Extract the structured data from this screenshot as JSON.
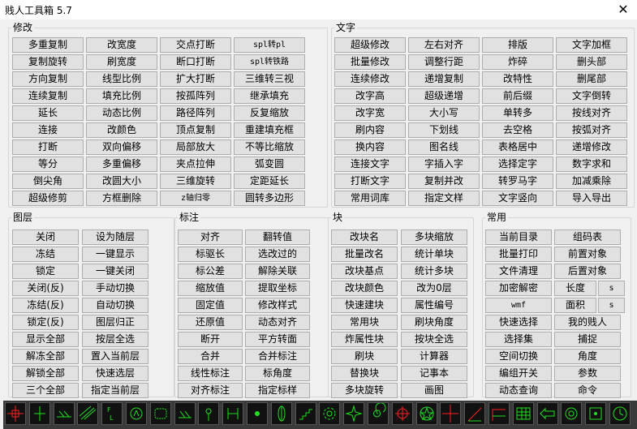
{
  "window": {
    "title": "贱人工具箱 5.7",
    "close_glyph": "✕"
  },
  "groups": {
    "modify": "修改",
    "text": "文字",
    "layer": "图层",
    "dim": "标注",
    "block": "块",
    "common": "常用"
  },
  "modify_buttons": [
    [
      "多重复制",
      "改宽度",
      "交点打断",
      "spl转pl"
    ],
    [
      "复制旋转",
      "刷宽度",
      "断口打断",
      "spl转铁路"
    ],
    [
      "方向复制",
      "线型比例",
      "扩大打断",
      "三维转三视"
    ],
    [
      "连续复制",
      "填充比例",
      "按孤阵列",
      "继承填充"
    ],
    [
      "延长",
      "动态比例",
      "路径阵列",
      "反复缩放"
    ],
    [
      "连接",
      "改颜色",
      "顶点复制",
      "重建填充框"
    ],
    [
      "打断",
      "双向偏移",
      "局部放大",
      "不等比缩放"
    ],
    [
      "等分",
      "多重偏移",
      "夹点拉伸",
      "弧变圆"
    ],
    [
      "倒尖角",
      "改圆大小",
      "三维旋转",
      "定距延长"
    ],
    [
      "超级修剪",
      "方框删除",
      "z轴归零",
      "圆转多边形"
    ]
  ],
  "text_buttons": [
    [
      "超级修改",
      "左右对齐",
      "排版",
      "文字加框"
    ],
    [
      "批量修改",
      "调整行距",
      "炸碎",
      "删头部"
    ],
    [
      "连续修改",
      "递增复制",
      "改特性",
      "删尾部"
    ],
    [
      "改字高",
      "超级递增",
      "前后缀",
      "文字倒转"
    ],
    [
      "改字宽",
      "大小写",
      "单转多",
      "按线对齐"
    ],
    [
      "刷内容",
      "下划线",
      "去空格",
      "按弧对齐"
    ],
    [
      "换内容",
      "图名线",
      "表格居中",
      "递增修改"
    ],
    [
      "连接文字",
      "字插入字",
      "选择定字",
      "数字求和"
    ],
    [
      "打断文字",
      "复制并改",
      "转罗马字",
      "加减乘除"
    ],
    [
      "常用词库",
      "指定文样",
      "文字竖向",
      "导入导出"
    ]
  ],
  "layer_buttons": [
    [
      "关闭",
      "设为随层"
    ],
    [
      "冻结",
      "一键显示"
    ],
    [
      "锁定",
      "一键关闭"
    ],
    [
      "关闭(反)",
      "手动切换"
    ],
    [
      "冻结(反)",
      "自动切换"
    ],
    [
      "锁定(反)",
      "图层归正"
    ],
    [
      "显示全部",
      "按层全选"
    ],
    [
      "解冻全部",
      "置入当前层"
    ],
    [
      "解锁全部",
      "快速选层"
    ],
    [
      "三个全部",
      "指定当前层"
    ]
  ],
  "dim_buttons": [
    [
      "对齐",
      "翻转值"
    ],
    [
      "标驱长",
      "选改过的"
    ],
    [
      "标公差",
      "解除关联"
    ],
    [
      "缩放值",
      "提取坐标"
    ],
    [
      "固定值",
      "修改样式"
    ],
    [
      "还原值",
      "动态对齐"
    ],
    [
      "断开",
      "平方转面"
    ],
    [
      "合并",
      "合并标注"
    ],
    [
      "线性标注",
      "标角度"
    ],
    [
      "对齐标注",
      "指定标样"
    ]
  ],
  "block_buttons": [
    [
      "改块名",
      "多块缩放"
    ],
    [
      "批量改名",
      "统计单块"
    ],
    [
      "改块基点",
      "统计多块"
    ],
    [
      "改块颜色",
      "改为0层"
    ],
    [
      "快速建块",
      "属性编号"
    ],
    [
      "常用块",
      "刷块角度"
    ],
    [
      "炸属性块",
      "按块全选"
    ],
    [
      "刷块",
      "计算器"
    ],
    [
      "替换块",
      "记事本"
    ],
    [
      "多块旋转",
      "画图"
    ]
  ],
  "common_buttons": {
    "rows": [
      [
        "当前目录",
        "组码表"
      ],
      [
        "批量打印",
        "前置对象"
      ],
      [
        "文件清理",
        "后置对象"
      ]
    ],
    "decrypt": "加密解密",
    "length": "长度",
    "wmf": "wmf",
    "area": "面积",
    "s1": "s",
    "s2": "s",
    "rows2": [
      [
        "快速选择",
        "我的贱人"
      ],
      [
        "选择集",
        "捕捉"
      ],
      [
        "空间切换",
        "角度"
      ],
      [
        "编组开关",
        "参数"
      ],
      [
        "动态查询",
        "命令"
      ]
    ]
  },
  "toolbar_icons": [
    "target-icon",
    "perpendicular-icon",
    "parallel-icon",
    "hatch-icon",
    "fx-icon",
    "circle-letter-icon",
    "cloud-icon",
    "ground-icon",
    "pin-icon",
    "branch-icon",
    "dot-icon",
    "sword-icon",
    "stairs-icon",
    "gear-icon",
    "star-burst-icon",
    "spiral-icon",
    "crosshair-icon",
    "pentagram-icon",
    "cross-icon",
    "diagonal-icon",
    "step-line-icon",
    "grid-icon",
    "arrow-left-icon",
    "ring-icon",
    "square-dot-icon",
    "clock-icon"
  ],
  "colors": {
    "icon_red": "#ff2020",
    "icon_green": "#20e020",
    "toolbar_bg": "#3a3a3a"
  }
}
